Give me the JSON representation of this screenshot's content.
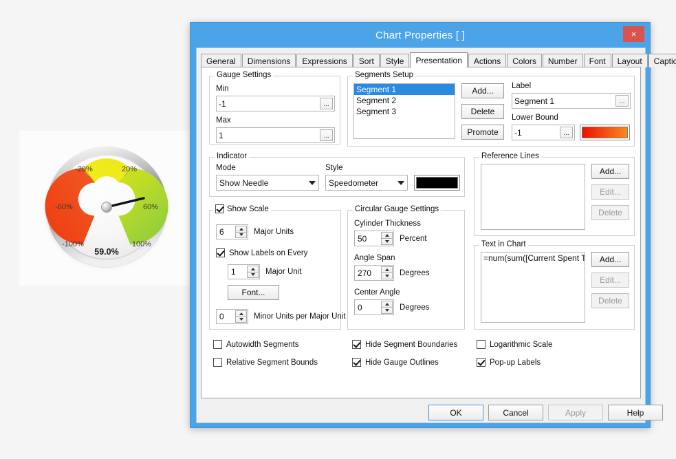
{
  "window": {
    "title": "Chart Properties [ ]",
    "close_label": "×",
    "close_icon": "close-icon"
  },
  "tabs": [
    {
      "label": "General",
      "active": false
    },
    {
      "label": "Dimensions",
      "active": false
    },
    {
      "label": "Expressions",
      "active": false
    },
    {
      "label": "Sort",
      "active": false
    },
    {
      "label": "Style",
      "active": false
    },
    {
      "label": "Presentation",
      "active": true
    },
    {
      "label": "Actions",
      "active": false
    },
    {
      "label": "Colors",
      "active": false
    },
    {
      "label": "Number",
      "active": false
    },
    {
      "label": "Font",
      "active": false
    },
    {
      "label": "Layout",
      "active": false
    },
    {
      "label": "Caption",
      "active": false
    }
  ],
  "gauge_settings": {
    "legend": "Gauge Settings",
    "min_label": "Min",
    "min_value": "-1",
    "max_label": "Max",
    "max_value": "1",
    "ellipsis": "..."
  },
  "segments_setup": {
    "legend": "Segments Setup",
    "items": [
      "Segment 1",
      "Segment 2",
      "Segment 3"
    ],
    "selected_index": 0,
    "add_label": "Add...",
    "delete_label": "Delete",
    "promote_label": "Promote",
    "label_caption": "Label",
    "label_value": "Segment 1",
    "lower_bound_caption": "Lower Bound",
    "lower_bound_value": "-1",
    "ellipsis": "...",
    "segment_color_start": "#ee1100",
    "segment_color_end": "#f78b1e"
  },
  "indicator": {
    "legend": "Indicator",
    "mode_label": "Mode",
    "mode_value": "Show Needle",
    "style_label": "Style",
    "style_value": "Speedometer",
    "needle_color": "#000000"
  },
  "show_scale": {
    "legend": "Show Scale",
    "checked": true,
    "major_units_value": "6",
    "major_units_label": "Major Units",
    "show_labels_every_label": "Show Labels on Every",
    "show_labels_every_checked": true,
    "major_unit_value": "1",
    "major_unit_label": "Major Unit",
    "font_button": "Font...",
    "minor_units_value": "0",
    "minor_units_label": "Minor Units per Major Unit"
  },
  "circular_gauge": {
    "legend": "Circular Gauge Settings",
    "cylinder_thickness_label": "Cylinder Thickness",
    "cylinder_thickness_value": "50",
    "cylinder_thickness_unit": "Percent",
    "angle_span_label": "Angle Span",
    "angle_span_value": "270",
    "angle_span_unit": "Degrees",
    "center_angle_label": "Center Angle",
    "center_angle_value": "0",
    "center_angle_unit": "Degrees"
  },
  "reference_lines": {
    "legend": "Reference Lines",
    "items": [],
    "add_label": "Add...",
    "edit_label": "Edit...",
    "delete_label": "Delete",
    "edit_disabled": true,
    "delete_disabled": true
  },
  "text_in_chart": {
    "legend": "Text in Chart",
    "items": [
      "=num(sum([Current Spent To Dat"
    ],
    "add_label": "Add...",
    "edit_label": "Edit...",
    "delete_label": "Delete",
    "edit_disabled": true,
    "delete_disabled": true
  },
  "options": [
    {
      "label": "Autowidth Segments",
      "checked": false
    },
    {
      "label": "Relative Segment Bounds",
      "checked": false
    },
    {
      "label": "Hide Segment Boundaries",
      "checked": true
    },
    {
      "label": "Hide Gauge Outlines",
      "checked": true
    },
    {
      "label": "Logarithmic Scale",
      "checked": false
    },
    {
      "label": "Pop-up Labels",
      "checked": true
    }
  ],
  "footer": {
    "ok": "OK",
    "cancel": "Cancel",
    "apply": "Apply",
    "help": "Help",
    "apply_disabled": true
  },
  "chart_data": {
    "type": "gauge",
    "title": "",
    "value": 0.59,
    "value_display": "59.0%",
    "min": -1,
    "max": 1,
    "angle_span": 270,
    "center_angle": 0,
    "major_units": 6,
    "tick_labels": [
      "-100%",
      "-60%",
      "-20%",
      "20%",
      "60%",
      "100%"
    ],
    "tick_values": [
      -1,
      -0.6,
      -0.2,
      0.2,
      0.6,
      1
    ],
    "segments": [
      {
        "name": "Segment 1",
        "lower_bound": -1,
        "color_start": "#ee1100",
        "color_end": "#f78b1e"
      },
      {
        "name": "Segment 2",
        "lower_bound": -0.333,
        "color_start": "#f2e71a",
        "color_end": "#e9e81b"
      },
      {
        "name": "Segment 3",
        "lower_bound": 0.333,
        "color_start": "#cfe01c",
        "color_end": "#97d13a"
      }
    ],
    "needle_color": "#111111",
    "style": "Speedometer"
  }
}
